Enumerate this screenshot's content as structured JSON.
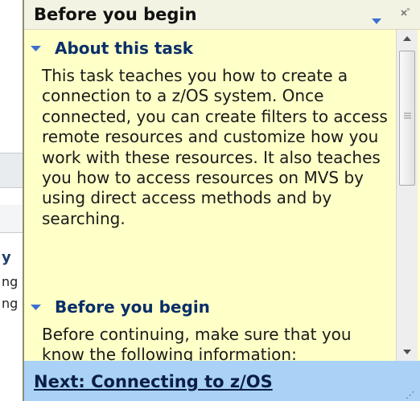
{
  "background_app": {
    "bold_text": "y",
    "line1_text": "ng",
    "line2_text": "ng"
  },
  "cheat_sheet": {
    "title": "Before you begin",
    "sections": [
      {
        "heading": "About this task",
        "body": "This task teaches you how to create a connection to a z/OS system. Once connected, you can create filters to access remote resources and customize how you work with these resources. It also teaches you how to access resources on MVS by using direct access methods and by searching."
      },
      {
        "heading": "Before you begin",
        "body": "Before continuing, make sure that you know the following information:"
      }
    ],
    "next_link": "Next: Connecting to z/OS"
  },
  "icons": {
    "menu": "view-menu-triangle-icon",
    "close": "close-icon",
    "expand": "expanded-triangle-icon",
    "scroll_up": "scroll-up-arrow-icon",
    "scroll_down": "scroll-down-arrow-icon",
    "grip": "scroll-grip-icon",
    "resize": "resize-grip-icon"
  },
  "colors": {
    "panel_background": "#ffffc8",
    "heading_text": "#0a2f68",
    "footer_background": "#a9d2f6",
    "triangle_blue": "#3d6fd1"
  }
}
